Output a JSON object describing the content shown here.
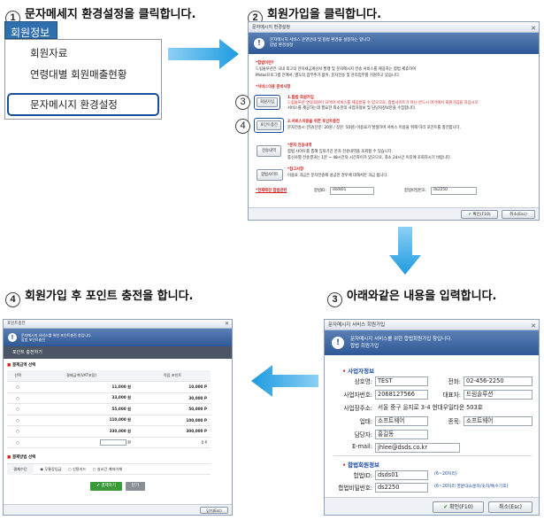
{
  "steps": {
    "s1": {
      "num": "1",
      "title": "문자메세지 환경설정을 클릭합니다."
    },
    "s2": {
      "num": "2",
      "title": "회원가입을 클릭합니다."
    },
    "s3": {
      "num": "3",
      "title": "아래와같은 내용을 입력합니다."
    },
    "s4": {
      "num": "4",
      "title": "회원가입 후 포인트 충전을 합니다."
    }
  },
  "menu": {
    "header": "회원정보",
    "items": [
      "회원자료",
      "연령대별 회원매출현황",
      "문자메시지 환경설정"
    ]
  },
  "callouts": {
    "c3": "3",
    "c4": "4"
  },
  "win2": {
    "title": "문자메시지 환경설정",
    "banner1": "문자메시지 서비스 운영안내 및 합법 환경을 설정하는 합니다.",
    "banner2": "합법 환경설정",
    "sec1_title": "*합법이란?",
    "sec1_l1": "드림솔루션은 국내 최고의 전자세금계산서 발행 및 문자메시지 전송 서비스를 제공하는 합법 제휴하여",
    "sec1_l2": "Midas프로그램 안에서, 별도의 업무추가 없이, 문자전송 및 관리업무를 지원하고 있습니다.",
    "sec2_title": "*서비스이용 준비사항",
    "sec2_a": "1.합법 회원가입",
    "sec2_a1": "드림솔루션 연동회원이 되어야 서비스를 제공받을 수 있으므로, 합법사이트가 아닌 반드시 여기에서 회원가입을 하십시오.",
    "sec2_a2": "서비스를 제공하는데 필요한 최소한의 사업자정보 및 담당자정보만을 수집합니다.",
    "sec2_b": "2.서비스이용을 위한 포인트충전",
    "sec2_b1": "문자전송시 건당(단문: 20원 / 장문: 50원) 이용료가 발생하며 서비스 이용을 위해 미리 포인트를 충전합니다.",
    "btn_join": "회원가입",
    "btn_point": "포인트충전",
    "btn_history": "전송내역",
    "btn_site": "합법사이트",
    "sec3_title": "*문자 전송내역",
    "sec3_l1": "합법 사이트를 통해 임의기간 문자 전송내역을 조회할 수 있습니다.",
    "sec3_l2": "통신사별 전송결과는 1분 ~ 48시간의 시간차이가 있으므로, 최소 24시간 이후에 조회하시기 바랍니다.",
    "sec4_title": "*참고사항",
    "sec4_l1": "이용료 과금은 문자전송에 성공한 경우에 대해서만 과금 됩니다.",
    "id_section": "*현재매장 합법관련",
    "id_label": "합법ID:",
    "id_value": "dsds01",
    "pw_label": "합법비밀번호:",
    "pw_value": "ds2250",
    "ok": "확인(F10)",
    "cancel": "취소(Esc)"
  },
  "win3": {
    "title": "문자메시지 서비스 회원가입",
    "banner1": "문자메시지 서비스를 위한 합법회원가입 창입니다.",
    "banner2": "합법 회원가입",
    "sec_biz": "사업자정보",
    "sec_join": "합법회원정보",
    "fields": {
      "company_label": "상호명:",
      "company": "TEST",
      "tel_label": "전화:",
      "tel": "02-456-2250",
      "bizno_label": "사업자번호:",
      "bizno": "2068127566",
      "ceo_label": "대표자:",
      "ceo": "드림솔루션",
      "addr_label": "사업장주소:",
      "addr": "서울 중구 을지로 3-4 현대우일타운 503호",
      "type_label": "업태:",
      "type": "소프트웨어",
      "item_label": "종목:",
      "item": "소프트웨어",
      "manager_label": "담당자:",
      "manager": "홍길동",
      "email_label": "E-mail:",
      "email": "jhlee@dsds.co.kr",
      "id_label": "합법ID:",
      "id": "dsds01",
      "id_hint": "(6~20자리)",
      "pw_label": "합법비밀번호:",
      "pw": "ds2250",
      "pw_hint": "(6~20자리 영문대소문자/숫자/특수기호)"
    },
    "ok": "확인(F10)",
    "cancel": "취소(Esc)"
  },
  "win4": {
    "title": "포인트충전",
    "banner1": "문자메시지 서비스를 위한 포인트충전 창입니다.",
    "banner2": "합법 포인트충전",
    "subtitle": "포인트 충전하기",
    "sec_amount": "결제금액 선택",
    "col_select": "선택",
    "col_amount": "결제금액(VAT포함)",
    "col_point": "적립 포인트",
    "rows": [
      {
        "amount": "11,000 원",
        "point": "10,000 P"
      },
      {
        "amount": "33,000 원",
        "point": "30,000 P"
      },
      {
        "amount": "55,000 원",
        "point": "50,000 P"
      },
      {
        "amount": "110,000 원",
        "point": "100,000 P"
      },
      {
        "amount": "330,000 원",
        "point": "300,000 P"
      },
      {
        "amount": "원",
        "point": "0 P"
      }
    ],
    "sec_method": "결제방법 선택",
    "method_label": "결제수단",
    "methods": [
      "무통장입금",
      "신용카드",
      "실시간 계좌이체"
    ],
    "pay_btn": "결제하기",
    "close_btn": "닫기",
    "foot_btn": "닫기(Esc)"
  },
  "colors": {
    "accent": "#1a4f9c",
    "arrow": "#1e9be0",
    "banner": "#2e5896",
    "alert": "#d41f1f"
  }
}
